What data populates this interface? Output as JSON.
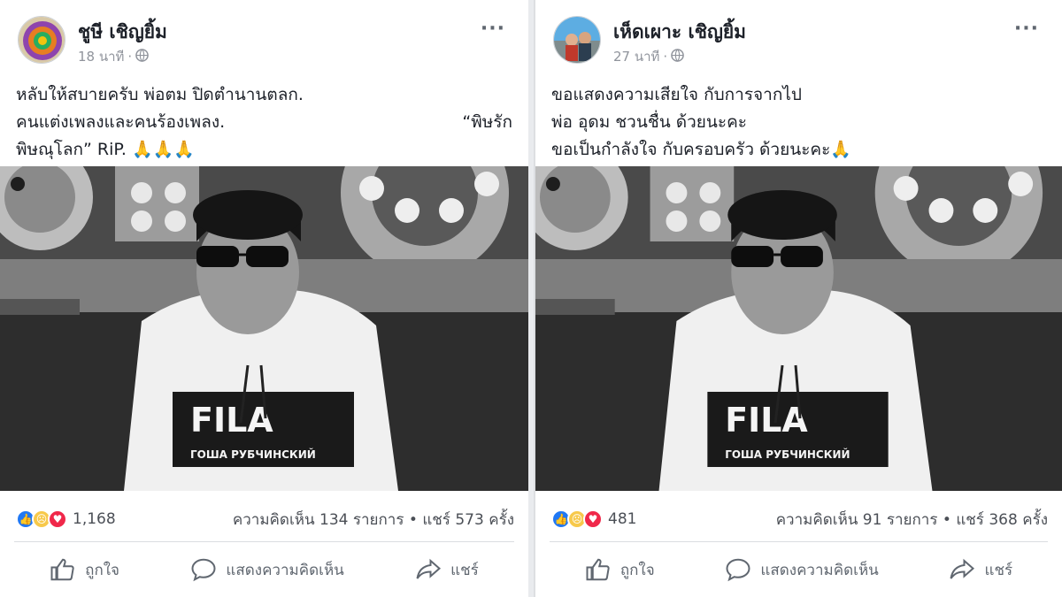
{
  "posts": [
    {
      "author": "ชูษี เชิญยิ้ม",
      "time": "18 นาที",
      "privacy_icon": "globe-icon",
      "more_icon": "more-options-icon",
      "text_lines": [
        "หลับให้สบายครับ พ่อตม ปิดตำนานตลก.",
        "คนแต่งเพลงและคนร้องเพลง.",
        "“พิษรัก",
        "พิษณุโลก”   RiP.  🙏🙏🙏"
      ],
      "reaction_count": "1,168",
      "comments": "ความคิดเห็น 134 รายการ",
      "shares": "แชร์ 573 ครั้ง",
      "separator": "•",
      "actions": {
        "like": "ถูกใจ",
        "comment": "แสดงความคิดเห็น",
        "share": "แชร์"
      }
    },
    {
      "author": "เห็ดเผาะ เชิญยิ้ม",
      "time": "27 นาที",
      "privacy_icon": "globe-icon",
      "more_icon": "more-options-icon",
      "text_lines": [
        "ขอแสดงความเสียใจ กับการจากไป",
        "พ่อ อุดม ชวนชื่น ด้วยนะคะ",
        "ขอเป็นกำลังใจ กับครอบครัว ด้วยนะคะ🙏"
      ],
      "reaction_count": "481",
      "comments": "ความคิดเห็น 91 รายการ",
      "shares": "แชร์ 368 ครั้ง",
      "separator": "•",
      "actions": {
        "like": "ถูกใจ",
        "comment": "แสดงความคิดเห็น",
        "share": "แชร์"
      }
    }
  ],
  "photo": {
    "hoodie_logo": "FILA",
    "hoodie_text": "ГОША РУБЧИНСКИЙ"
  },
  "colors": {
    "like_blue": "#2078f4",
    "sad_yellow": "#f7c94b",
    "love_red": "#f0284a",
    "muted_text": "#606770"
  }
}
